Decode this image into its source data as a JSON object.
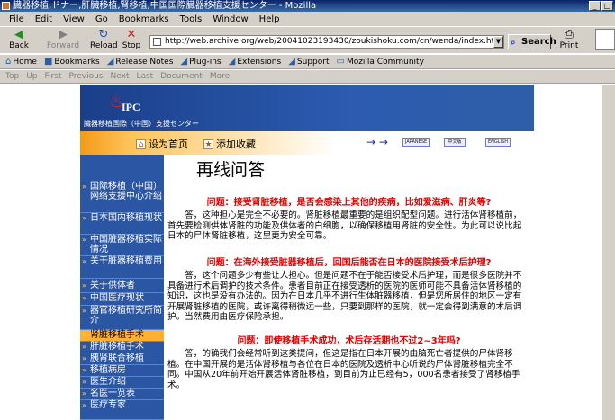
{
  "window": {
    "title": "臓器移植,ドナー,肝臓移植,腎移植,中国国際臓器移植支援センター - Mozilla",
    "controls": [
      "_",
      "□",
      "×"
    ]
  },
  "menu": [
    "File",
    "Edit",
    "View",
    "Go",
    "Bookmarks",
    "Tools",
    "Window",
    "Help"
  ],
  "nav": {
    "back": "Back",
    "forward": "Forward",
    "reload": "Reload",
    "stop": "Stop",
    "url": "http://web.archive.org/web/20041023193430/zoukishoku.com/cn/wenda/index.htm",
    "search": "Search",
    "print": "Print"
  },
  "personal_toolbar": [
    "Home",
    "Bookmarks",
    "Release Notes",
    "Plug-ins",
    "Extensions",
    "Support",
    "Mozilla Community"
  ],
  "site_nav": [
    "Top",
    "Up",
    "First",
    "Previous",
    "Next",
    "Last",
    "Document",
    "More"
  ],
  "banner": {
    "logo_text": "IPC",
    "subtitle": "臓器移植国際（中国）支援センター"
  },
  "quicklinks": {
    "home": "设为首页",
    "favorite": "添加收藏",
    "lang_ja": "JAPANESE",
    "lang_zh": "中文版",
    "lang_en": "ENGLISH"
  },
  "sidebar": [
    "国际移植（中国）网络支援中心介绍",
    "日本国内移植现状",
    "中国脏器移植实际情况",
    "关于脏器移植费用",
    "关于供体者",
    "中国医疗现状",
    "器官移植研究所简介",
    "肾脏移植手术",
    "肝脏移植手术",
    "胰肾联合移植",
    "移植病房",
    "医生介绍",
    "名医一览表",
    "医疗专家"
  ],
  "main": {
    "title": "再线问答",
    "qa": [
      {
        "q": "问题：接受肾脏移植，是否会感染上其他的疾病，比如爱滋病、肝炎等?",
        "a": "答，这种担心是完全不必要的。肾脏移植最重要的是组织配型问题。进行活体肾移植前，首先要检测供体肾脏的功能及供体者的白细胞，以确保移植用肾脏的安全性。为此可以说比起日本的尸体肾脏移植，这里更为安全可靠。"
      },
      {
        "q": "问题：在海外接受脏器移植后，回国后能否在日本的医院接受术后护理?",
        "a": "答，这个问题多少有些让人担心。但是问题不在于能否接受术后护理，而是很多医院并不具备进行术后调护的技术条件。患者目前正在接受透析的医院的医师可能不具备活体肾移植的知识，这也是没有办法的。因为在日本几乎不进行生体脏器移植，但是您所居住的地区一定有开展肾脏移植的医院，或许离得稍微远一些，只要到那样的医院，就一定会得到满意的术后调护。当然费用由医疗保险承担。"
      },
      {
        "q": "问题：即使移植手术成功，术后存活期也不过2~3年吗?",
        "a": "答，的确我们会经常听到这类提问，但这是指在日本开展的由脑死亡者提供的尸体肾移植。在中国开展的是活体肾移植与各位在日本的医院及透析中心听说的尸体肾脏移植完全不同。中国从20年前开始开展活体肾脏移植，到目前为止已经有5，000名患者接受了肾移植手术。"
      }
    ]
  }
}
